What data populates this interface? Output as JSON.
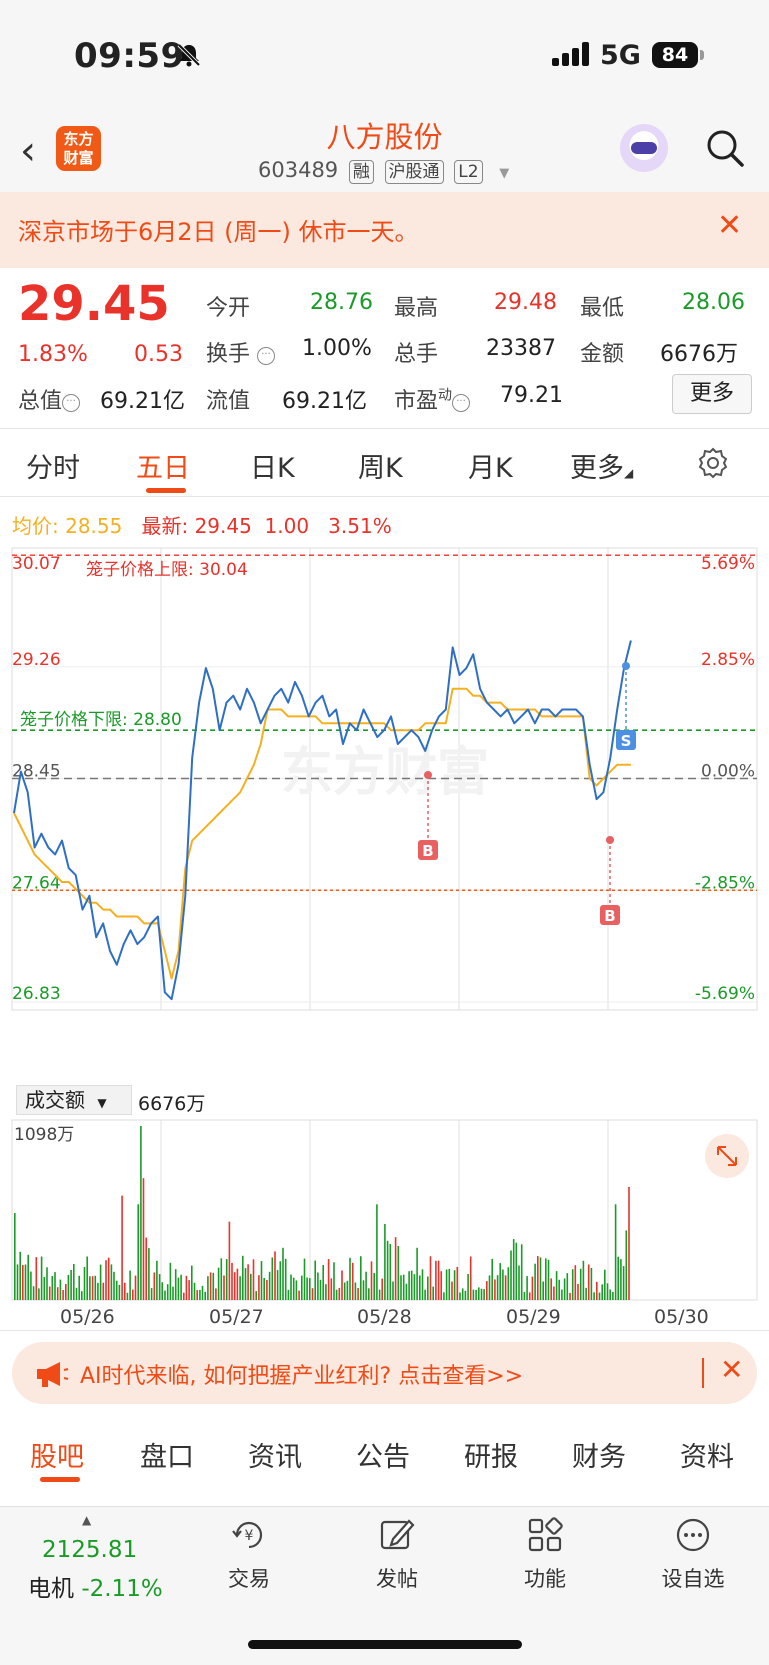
{
  "status_bar": {
    "time": "09:59",
    "network": "5G",
    "battery": "84"
  },
  "header": {
    "logo_line1": "东方",
    "logo_line2": "财富",
    "stock_name": "八方股份",
    "stock_code": "603489",
    "tags": [
      "融",
      "沪股通",
      "L2"
    ]
  },
  "notice": {
    "text": "深京市场于6月2日 (周一) 休市一天。"
  },
  "quote": {
    "price": "29.45",
    "change_pct": "1.83%",
    "change": "0.53",
    "open_label": "今开",
    "open": "28.76",
    "high_label": "最高",
    "high": "29.48",
    "low_label": "最低",
    "low": "28.06",
    "turnover_label": "换手",
    "turnover": "1.00%",
    "volume_label": "总手",
    "volume": "23387",
    "amount_label": "金额",
    "amount": "6676万",
    "mktcap_label": "总值",
    "mktcap": "69.21亿",
    "float_label": "流值",
    "float": "69.21亿",
    "pe_label": "市盈",
    "pe_sup": "动",
    "pe": "79.21",
    "more_button": "更多"
  },
  "tabs": [
    "分时",
    "五日",
    "日K",
    "周K",
    "月K",
    "更多"
  ],
  "active_tab": "五日",
  "chart_info": {
    "avg_label": "均价:",
    "avg": "28.55",
    "latest_label": "最新:",
    "latest": "29.45",
    "chg": "1.00",
    "chg_pct": "3.51%"
  },
  "chart_data": {
    "type": "line",
    "x": [
      "05/26",
      "05/27",
      "05/28",
      "05/29",
      "05/30"
    ],
    "ylim": [
      26.83,
      30.07
    ],
    "y_ticks_left": [
      "30.07",
      "29.26",
      "28.45",
      "27.64",
      "26.83"
    ],
    "y_ticks_right": [
      "5.69%",
      "2.85%",
      "0.00%",
      "-2.85%",
      "-5.69%"
    ],
    "upper_limit_label": "笼子价格上限: 30.04",
    "upper_limit": 30.04,
    "lower_limit_label": "笼子价格下限: 28.80",
    "lower_limit": 28.8,
    "prev_close": 28.45,
    "support_line": 27.64,
    "watermark": "东方财富",
    "markers": [
      "B",
      "S",
      "B"
    ],
    "series": [
      {
        "values": [
          28.2,
          28.5,
          28.35,
          27.95,
          28.05,
          27.95,
          27.9,
          28.0,
          27.8,
          27.75,
          27.5,
          27.6,
          27.3,
          27.4,
          27.2,
          27.1,
          27.25,
          27.35,
          27.25,
          27.3,
          27.4,
          27.45,
          26.9,
          26.85,
          27.1,
          27.6,
          28.6,
          29.0,
          29.25,
          29.1,
          28.8,
          29.0,
          29.05,
          28.95,
          29.1,
          29.0,
          28.85,
          28.95,
          29.05,
          29.1,
          29.0,
          29.15,
          29.05,
          28.9,
          29.0,
          29.05,
          28.9,
          28.95,
          28.7,
          28.85,
          28.8,
          28.95,
          28.85,
          28.75,
          28.8,
          28.9,
          28.7,
          28.75,
          28.8,
          28.75,
          28.65,
          28.8,
          28.9,
          28.95,
          29.4,
          29.2,
          29.25,
          29.35,
          29.1,
          29.0,
          28.95,
          28.9,
          28.95,
          28.85,
          28.9,
          28.95,
          28.85,
          28.95,
          28.95,
          28.9,
          28.95,
          28.95,
          28.95,
          28.9,
          28.55,
          28.3,
          28.35,
          28.6,
          28.95,
          29.25,
          29.45
        ]
      },
      {
        "values": [
          28.2,
          28.1,
          28.0,
          27.9,
          27.85,
          27.8,
          27.75,
          27.7,
          27.7,
          27.65,
          27.6,
          27.55,
          27.55,
          27.5,
          27.5,
          27.45,
          27.45,
          27.45,
          27.45,
          27.4,
          27.4,
          27.4,
          27.2,
          27.0,
          27.2,
          27.8,
          28.0,
          28.05,
          28.1,
          28.15,
          28.2,
          28.25,
          28.3,
          28.35,
          28.45,
          28.55,
          28.7,
          28.95,
          28.95,
          28.95,
          28.9,
          28.9,
          28.9,
          28.9,
          28.9,
          28.85,
          28.85,
          28.85,
          28.85,
          28.85,
          28.85,
          28.85,
          28.85,
          28.85,
          28.85,
          28.8,
          28.8,
          28.8,
          28.8,
          28.8,
          28.85,
          28.85,
          28.85,
          28.85,
          29.1,
          29.1,
          29.1,
          29.05,
          29.05,
          29.0,
          29.0,
          29.0,
          28.95,
          28.95,
          28.95,
          28.95,
          28.95,
          28.9,
          28.9,
          28.9,
          28.9,
          28.9,
          28.9,
          28.9,
          28.45,
          28.4,
          28.45,
          28.5,
          28.55,
          28.55,
          28.55
        ]
      }
    ],
    "volume_axis_max": "1098万"
  },
  "volume": {
    "selector": "成交额",
    "value": "6676万"
  },
  "ad": {
    "text": "AI时代来临, 如何把握产业红利? 点击查看>>"
  },
  "bottom_tabs": [
    "股吧",
    "盘口",
    "资讯",
    "公告",
    "研报",
    "财务",
    "资料"
  ],
  "active_bottom_tab": "股吧",
  "bottom_bar": {
    "index_value": "2125.81",
    "index_name": "电机",
    "index_change": "-2.11%",
    "nav": [
      {
        "label": "交易",
        "icon": "trade-icon"
      },
      {
        "label": "发帖",
        "icon": "edit-icon"
      },
      {
        "label": "功能",
        "icon": "grid-icon"
      },
      {
        "label": "设自选",
        "icon": "more-dots-icon"
      }
    ]
  },
  "colors": {
    "up": "#e8322a",
    "down": "#1a9b28",
    "accent": "#f04b16",
    "avg_line": "#f5b020",
    "price_line": "#2e6fc5"
  }
}
